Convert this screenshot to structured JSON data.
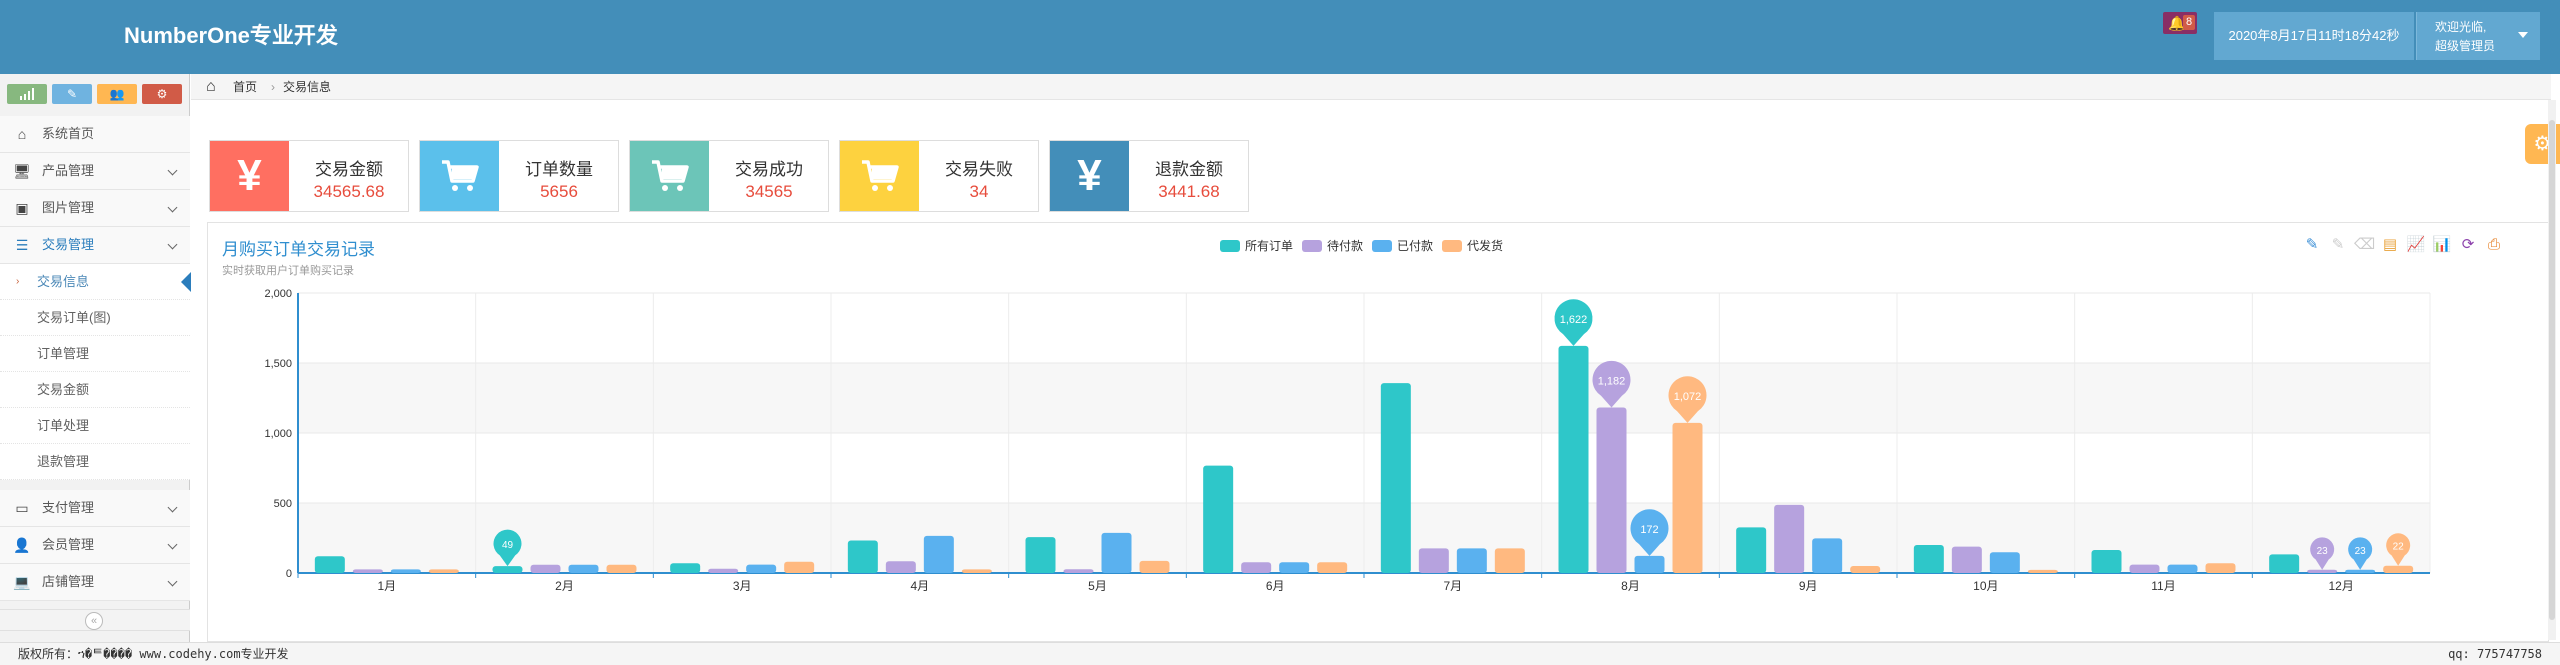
{
  "header": {
    "brand": "NumberOne专业开发",
    "notification_count": "8",
    "datetime": "2020年8月17日11时18分42秒",
    "welcome": "欢迎光临,",
    "role": "超级管理员"
  },
  "shortcuts": [
    {
      "icon": "signal-icon",
      "color": "#87b87f"
    },
    {
      "icon": "pencil-icon",
      "color": "#6fb3e0"
    },
    {
      "icon": "group-icon",
      "color": "#ffb752"
    },
    {
      "icon": "cogs-icon",
      "color": "#d15b47"
    }
  ],
  "sidebar": {
    "items": [
      {
        "label": "系统首页",
        "icon": "home-icon",
        "has_arrow": false
      },
      {
        "label": "产品管理",
        "icon": "desktop-icon",
        "has_arrow": true
      },
      {
        "label": "图片管理",
        "icon": "picture-icon",
        "has_arrow": true
      },
      {
        "label": "交易管理",
        "icon": "list-icon",
        "has_arrow": true,
        "open": true
      },
      {
        "label": "支付管理",
        "icon": "credit-card-icon",
        "has_arrow": true
      },
      {
        "label": "会员管理",
        "icon": "user-icon",
        "has_arrow": true
      },
      {
        "label": "店铺管理",
        "icon": "laptop-icon",
        "has_arrow": true
      }
    ],
    "sub_items": [
      "交易信息",
      "交易订单(图)",
      "订单管理",
      "交易金额",
      "订单处理",
      "退款管理"
    ],
    "active_sub": "交易信息"
  },
  "breadcrumb": {
    "home": "首页",
    "current": "交易信息"
  },
  "stats": [
    {
      "label": "交易金额",
      "value": "34565.68",
      "icon": "yen-icon",
      "color": "#ff6f61"
    },
    {
      "label": "订单数量",
      "value": "5656",
      "icon": "cart-icon",
      "color": "#5bc0eb"
    },
    {
      "label": "交易成功",
      "value": "34565",
      "icon": "cart-icon",
      "color": "#6cc5b8"
    },
    {
      "label": "交易失败",
      "value": "34",
      "icon": "cart-icon",
      "color": "#fdd23f"
    },
    {
      "label": "退款金额",
      "value": "3441.68",
      "icon": "yen-icon",
      "color": "#438eb9"
    }
  ],
  "chart": {
    "title": "月购买订单交易记录",
    "subtitle": "实时获取用户订单购买记录"
  },
  "toolbox": [
    {
      "icon": "mark-icon",
      "color": "#3b8fd6"
    },
    {
      "icon": "mark-undo-icon",
      "color": "#cccccc"
    },
    {
      "icon": "mark-clear-icon",
      "color": "#cccccc"
    },
    {
      "icon": "data-view-icon",
      "color": "#e8a23a"
    },
    {
      "icon": "line-chart-icon",
      "color": "#3b8fd6"
    },
    {
      "icon": "bar-chart-icon",
      "color": "#3aa846"
    },
    {
      "icon": "restore-icon",
      "color": "#8e44ad"
    },
    {
      "icon": "save-image-icon",
      "color": "#e67e22"
    }
  ],
  "chart_data": {
    "type": "bar",
    "title": "月购买订单交易记录",
    "subtitle": "实时获取用户订单购买记录",
    "categories": [
      "1月",
      "2月",
      "3月",
      "4月",
      "5月",
      "6月",
      "7月",
      "8月",
      "9月",
      "10月",
      "11月",
      "12月"
    ],
    "series": [
      {
        "name": "所有订单",
        "color": "#2ec7c9",
        "values": [
          120,
          49,
          70,
          232,
          256,
          767,
          1356,
          1622,
          326,
          200,
          164,
          133
        ]
      },
      {
        "name": "待付款",
        "color": "#b6a2de",
        "values": [
          26,
          59,
          30,
          84,
          27,
          77,
          176,
          1182,
          487,
          188,
          60,
          23
        ]
      },
      {
        "name": "已付款",
        "color": "#5ab1ef",
        "values": [
          26,
          59,
          60,
          265,
          287,
          77,
          176,
          122,
          247,
          148,
          60,
          23
        ]
      },
      {
        "name": "代发货",
        "color": "#ffb980",
        "values": [
          26,
          59,
          80,
          26,
          87,
          77,
          176,
          1072,
          50,
          22,
          70,
          52
        ]
      }
    ],
    "max_markers": [
      {
        "series": 0,
        "month": 7,
        "label": "1,622"
      },
      {
        "series": 1,
        "month": 7,
        "label": "1,182"
      },
      {
        "series": 2,
        "month": 7,
        "label": "172"
      },
      {
        "series": 3,
        "month": 7,
        "label": "1,072"
      }
    ],
    "min_markers": [
      {
        "series": 0,
        "month": 1,
        "label": "49"
      },
      {
        "series": 1,
        "month": 11,
        "label": "23"
      },
      {
        "series": 2,
        "month": 11,
        "label": "23"
      },
      {
        "series": 3,
        "month": 11,
        "label": "22"
      }
    ],
    "ylim": [
      0,
      2000
    ],
    "yticks": [
      "0",
      "500",
      "1,000",
      "1,500",
      "2,000"
    ],
    "legend_position": "top-center",
    "grid": true
  },
  "footer": {
    "copyright": "版权所有：ኀ�ᄐ���� www.codehy.com专业开发",
    "qq": "qq: 775747758"
  }
}
